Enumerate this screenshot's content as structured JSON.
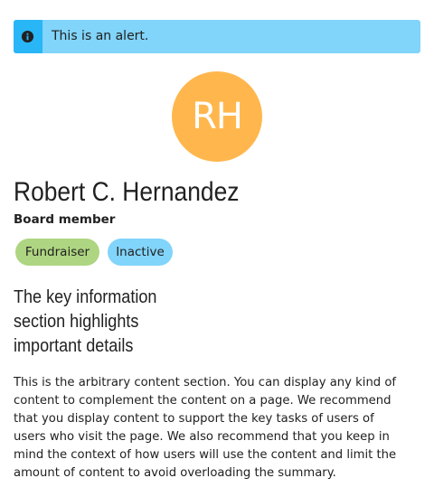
{
  "alert": {
    "icon": "info-icon",
    "text": "This is an alert.",
    "background": "#81d4fa",
    "icon_background": "#29b6f6"
  },
  "profile": {
    "initials": "RH",
    "avatar_color": "#ffb74d",
    "name": "Robert C. Hernandez",
    "role": "Board member",
    "tags": [
      {
        "label": "Fundraiser",
        "color": "#aed581"
      },
      {
        "label": "Inactive",
        "color": "#81d4fa"
      }
    ]
  },
  "key_info": {
    "lines": [
      "The key information",
      "section highlights",
      "important details"
    ]
  },
  "content": {
    "lines": [
      "This is the arbitrary content section. You can display any kind of",
      "content to complement the content on a page. We recommend",
      "that you display content to support the key tasks of users of",
      "users who visit the page. We also recommend that you keep in",
      "mind the context of how users will use the content and limit the",
      "amount of content to avoid overloading the summary."
    ]
  }
}
